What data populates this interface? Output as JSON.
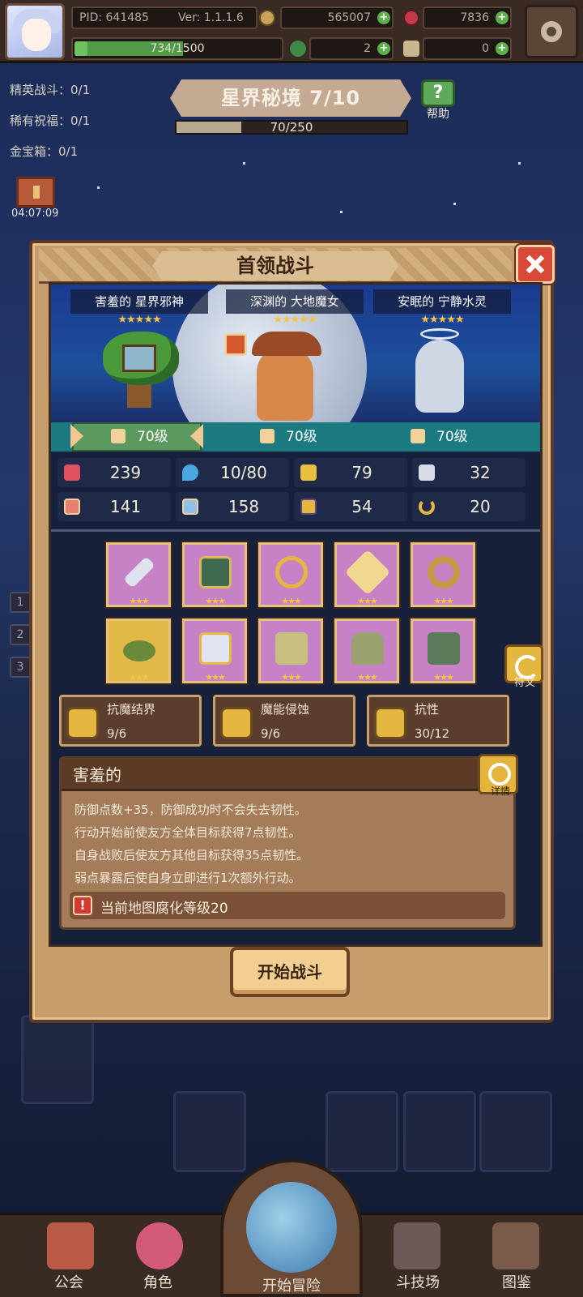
{
  "topbar": {
    "pid": "PID: 641485",
    "version": "Ver: 1.1.1.6",
    "gold": "565007",
    "gems": "7836",
    "exp": "734/1500",
    "clover": "2",
    "item": "0"
  },
  "left_info": {
    "elite": "精英战斗：0/1",
    "rare": "稀有祝福：0/1",
    "chest": "金宝箱：0/1",
    "timer": "04:07:09"
  },
  "stage": {
    "title": "星界秘境 7/10",
    "progress_text": "70/250",
    "progress": 0.28,
    "help_label": "帮助"
  },
  "modal": {
    "title": "首领战斗",
    "bosses": [
      {
        "name": "害羞的 星界邪神",
        "stars": "★★★★★",
        "level": "70级"
      },
      {
        "name": "深渊的 大地魔女",
        "stars": "★★★★★",
        "level": "70级"
      },
      {
        "name": "安眠的 宁静水灵",
        "stars": "★★★★★",
        "level": "70级"
      }
    ],
    "stats": [
      {
        "icon": "heart-icon",
        "value": "239"
      },
      {
        "icon": "water-drop-icon",
        "value": "10/80"
      },
      {
        "icon": "shield-icon",
        "value": "79"
      },
      {
        "icon": "wing-icon",
        "value": "32"
      },
      {
        "icon": "fist-icon",
        "value": "141"
      },
      {
        "icon": "book-icon",
        "value": "158"
      },
      {
        "icon": "stairs-icon",
        "value": "54"
      },
      {
        "icon": "horseshoe-icon",
        "value": "20"
      }
    ],
    "equipment_stars": "★★★",
    "rune_label": "符文",
    "bonuses": [
      {
        "name": "抗魔结界",
        "value": "9/6"
      },
      {
        "name": "魔能侵蚀",
        "value": "9/6"
      },
      {
        "name": "抗性",
        "value": "30/12"
      }
    ],
    "trait": {
      "name": "害羞的",
      "detail_label": "详情",
      "lines": [
        "防御点数+35，防御成功时不会失去韧性。",
        "行动开始前使友方全体目标获得7点韧性。",
        "自身战败后使友方其他目标获得35点韧性。",
        "弱点暴露后使自身立即进行1次额外行动。"
      ],
      "warning": "当前地图腐化等级20"
    },
    "start_label": "开始战斗"
  },
  "nav": {
    "guild": "公会",
    "character": "角色",
    "adventure": "开始冒险",
    "arena": "斗技场",
    "codex": "图鉴"
  },
  "colors": {
    "accent_red": "#d84938",
    "gold": "#e6b740",
    "star": "#f6c445"
  }
}
